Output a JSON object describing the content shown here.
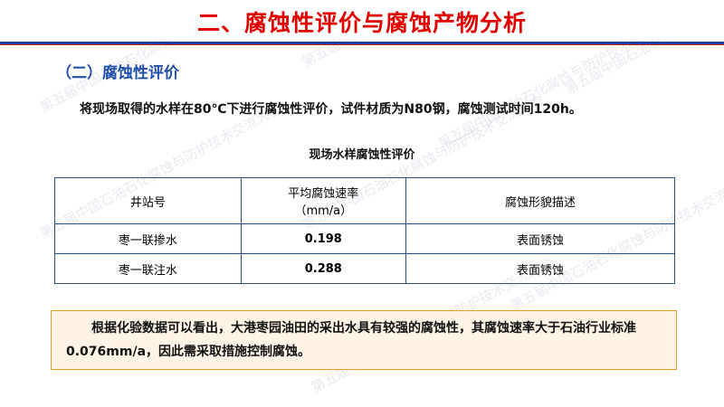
{
  "header": {
    "title": "二、腐蚀性评价与腐蚀产物分析"
  },
  "section": {
    "subtitle": "（二）腐蚀性评价"
  },
  "intro": "将现场取得的水样在80℃下进行腐蚀性评价，试件材质为N80钢，腐蚀测试时间120h。",
  "table": {
    "caption": "现场水样腐蚀性评价",
    "headers": {
      "well": "井站号",
      "rate_line1": "平均腐蚀速率",
      "rate_line2": "（mm/a）",
      "desc": "腐蚀形貌描述"
    },
    "rows": [
      {
        "well": "枣一联掺水",
        "rate": "0.198",
        "desc": "表面锈蚀"
      },
      {
        "well": "枣一联注水",
        "rate": "0.288",
        "desc": "表面锈蚀"
      }
    ]
  },
  "conclusion": "根据化验数据可以看出，大港枣园油田的采出水具有较强的腐蚀性，其腐蚀速率大于石油行业标准0.076mm/a，因此需采取措施控制腐蚀。",
  "watermark": {
    "text": "第五届中国石油石化腐蚀与防护技术交流大会"
  },
  "colors": {
    "title_red": "#e00000",
    "subtitle_blue": "#1f4fa8",
    "rule_blue": "#1f3f9c",
    "box_border": "#e89a2c",
    "box_fill": "#fdf4e6"
  }
}
